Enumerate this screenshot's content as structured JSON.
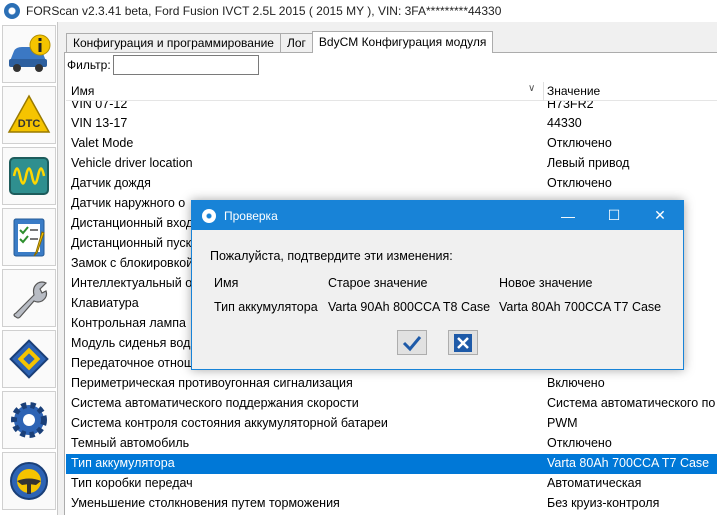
{
  "window": {
    "title": "FORScan v2.3.41 beta, Ford Fusion IVCT 2.5L 2015 ( 2015 MY ), VIN: 3FA*********44330"
  },
  "toolbar": {
    "items": [
      {
        "icon": "vehicle-info-icon"
      },
      {
        "icon": "dtc-icon"
      },
      {
        "icon": "oscilloscope-icon"
      },
      {
        "icon": "checklist-icon"
      },
      {
        "icon": "wrench-icon"
      },
      {
        "icon": "chip-icon"
      },
      {
        "icon": "settings-gear-icon"
      },
      {
        "icon": "steering-wheel-icon"
      }
    ]
  },
  "tabs": [
    {
      "label": "Конфигурация и программирование"
    },
    {
      "label": "Лог"
    },
    {
      "label": "BdyCM Конфигурация модуля"
    }
  ],
  "filter": {
    "label": "Фильтр:",
    "value": ""
  },
  "list": {
    "header_name": "Имя",
    "header_value": "Значение",
    "rows": [
      {
        "name": "VIN 07-12",
        "value": "H73FR2"
      },
      {
        "name": "VIN 13-17",
        "value": "44330"
      },
      {
        "name": "Valet Mode",
        "value": "Отключено"
      },
      {
        "name": "Vehicle driver location",
        "value": "Левый привод"
      },
      {
        "name": "Датчик дождя",
        "value": "Отключено"
      },
      {
        "name": "Датчик наружного о",
        "value": ""
      },
      {
        "name": "Дистанционный вход",
        "value": ""
      },
      {
        "name": "Дистанционный пуск",
        "value": ""
      },
      {
        "name": "Замок с блокировкой",
        "value": ""
      },
      {
        "name": "Интеллектуальный от",
        "value": ""
      },
      {
        "name": "Клавиатура",
        "value": ""
      },
      {
        "name": "Контрольная лампа",
        "value": ""
      },
      {
        "name": "Модуль сиденья вод",
        "value": ""
      },
      {
        "name": "Передаточное отнош",
        "value": ""
      },
      {
        "name": "Периметрическая противоугонная сигнализация",
        "value": "Включено"
      },
      {
        "name": "Система автоматического поддержания скорости",
        "value": "Система автоматического по"
      },
      {
        "name": "Система контроля состояния аккумуляторной батареи",
        "value": "PWM"
      },
      {
        "name": "Темный автомобиль",
        "value": "Отключено"
      },
      {
        "name": "Тип аккумулятора",
        "value": "Varta 80Ah 700CCA T7 Case"
      },
      {
        "name": "Тип коробки передач",
        "value": "Автоматическая"
      },
      {
        "name": "Уменьшение столкновения путем торможения",
        "value": "Без круиз-контроля"
      }
    ]
  },
  "dialog": {
    "title": "Проверка",
    "message": "Пожалуйста, подтвердите эти изменения:",
    "col_name": "Имя",
    "col_old": "Старое значение",
    "col_new": "Новое значение",
    "row_name": "Тип аккумулятора",
    "row_old": "Varta 90Ah 800CCA T8 Case",
    "row_new": "Varta 80Ah 700CCA T7 Case"
  }
}
